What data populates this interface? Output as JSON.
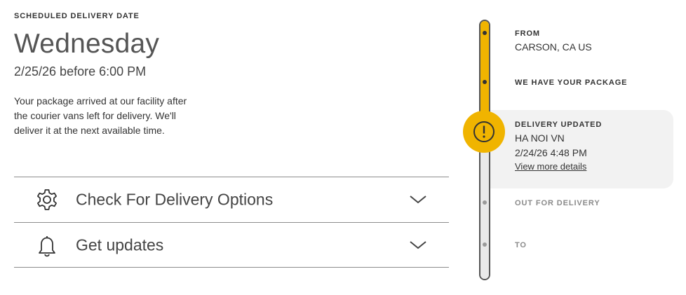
{
  "schedule": {
    "label": "SCHEDULED DELIVERY DATE",
    "day": "Wednesday",
    "date_time": "2/25/26 before 6:00 PM",
    "message": "Your package arrived at our facility after the courier vans left for delivery. We'll deliver it at the next available time."
  },
  "accordion": [
    {
      "label": "Check For Delivery Options",
      "icon": "gear-icon"
    },
    {
      "label": "Get updates",
      "icon": "bell-icon"
    }
  ],
  "timeline": {
    "from": {
      "heading": "FROM",
      "location": "CARSON, CA US"
    },
    "received": {
      "heading": "WE HAVE YOUR PACKAGE"
    },
    "updated": {
      "heading": "DELIVERY UPDATED",
      "location": "HA NOI VN",
      "datetime": "2/24/26 4:48 PM",
      "link": "View more details",
      "icon": "alert-icon"
    },
    "out_for_delivery": {
      "heading": "OUT FOR DELIVERY"
    },
    "to": {
      "heading": "TO"
    }
  },
  "colors": {
    "accent": "#f0b400",
    "text": "#333333",
    "muted": "#8a8a8a",
    "highlight": "#f2f2f2"
  }
}
